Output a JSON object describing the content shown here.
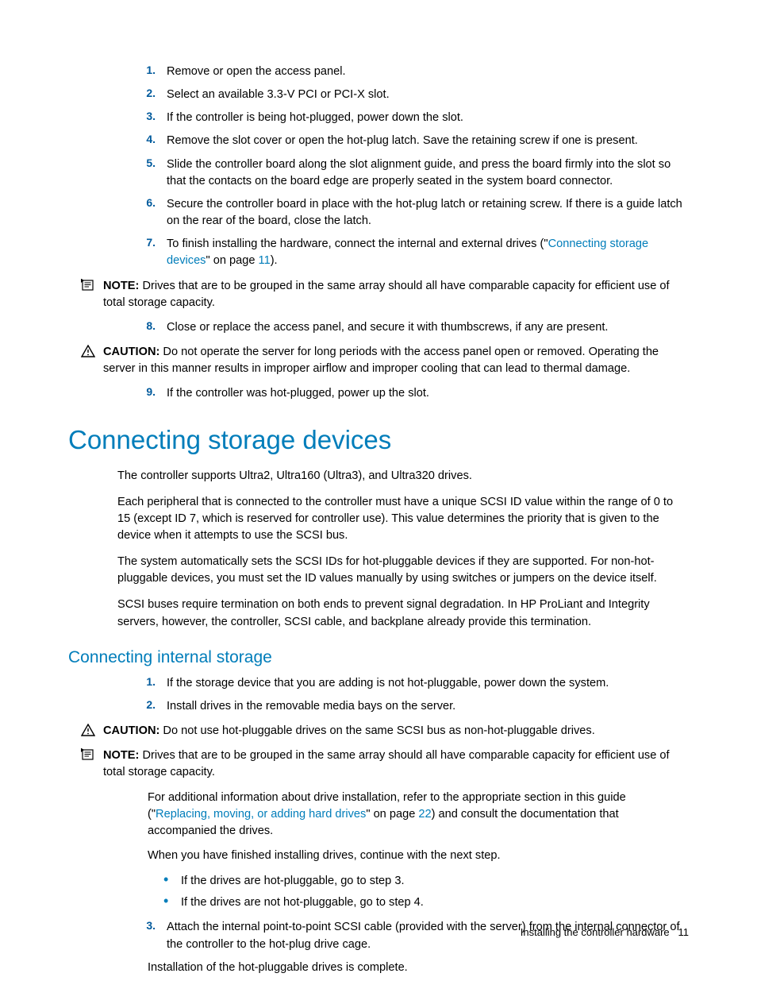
{
  "steps1": {
    "s1": "Remove or open the access panel.",
    "s2": "Select an available 3.3-V PCI or PCI-X slot.",
    "s3": "If the controller is being hot-plugged, power down the slot.",
    "s4": "Remove the slot cover or open the hot-plug latch. Save the retaining screw if one is present.",
    "s5": "Slide the controller board along the slot alignment guide, and press the board firmly into the slot so that the contacts on the board edge are properly seated in the system board connector.",
    "s6": "Secure the controller board in place with the hot-plug latch or retaining screw. If there is a guide latch on the rear of the board, close the latch.",
    "s7_pre": "To finish installing the hardware, connect the internal and external drives (\"",
    "s7_link": "Connecting storage devices",
    "s7_mid": "\" on page ",
    "s7_page": "11",
    "s7_post": ").",
    "s8": "Close or replace the access panel, and secure it with thumbscrews, if any are present.",
    "s9": "If the controller was hot-plugged, power up the slot."
  },
  "labels": {
    "note": "NOTE:",
    "caution": "CAUTION:"
  },
  "note1": " Drives that are to be grouped in the same array should all have comparable capacity for efficient use of total storage capacity.",
  "caution1": " Do not operate the server for long periods with the access panel open or removed. Operating the server in this manner results in improper airflow and improper cooling that can lead to thermal damage.",
  "h1": "Connecting storage devices",
  "csd": {
    "p1": "The controller supports Ultra2, Ultra160 (Ultra3), and Ultra320 drives.",
    "p2": "Each peripheral that is connected to the controller must have a unique SCSI ID value within the range of 0 to 15 (except ID 7, which is reserved for controller use). This value determines the priority that is given to the device when it attempts to use the SCSI bus.",
    "p3": "The system automatically sets the SCSI IDs for hot-pluggable devices if they are supported. For non-hot-pluggable devices, you must set the ID values manually by using switches or jumpers on the device itself.",
    "p4": "SCSI buses require termination on both ends to prevent signal degradation. In HP ProLiant and Integrity servers, however, the controller, SCSI cable, and backplane already provide this termination."
  },
  "h2": "Connecting internal storage",
  "steps2": {
    "s1": "If the storage device that you are adding is not hot-pluggable, power down the system.",
    "s2": "Install drives in the removable media bays on the server.",
    "s3": "Attach the internal point-to-point SCSI cable (provided with the server) from the internal connector of the controller to the hot-plug drive cage.",
    "s3b": "Installation of the hot-pluggable drives is complete."
  },
  "caution2": " Do not use hot-pluggable drives on the same SCSI bus as non-hot-pluggable drives.",
  "note2": " Drives that are to be grouped in the same array should all have comparable capacity for efficient use of total storage capacity.",
  "sub": {
    "p1_pre": "For additional information about drive installation, refer to the appropriate section in this guide (\"",
    "p1_link": "Replacing, moving, or adding hard drives",
    "p1_mid": "\" on page ",
    "p1_page": "22",
    "p1_post": ") and consult the documentation that accompanied the drives.",
    "p2": "When you have finished installing drives, continue with the next step.",
    "b1": "If the drives are hot-pluggable, go to step 3.",
    "b2": "If the drives are not hot-pluggable, go to step 4."
  },
  "nums": {
    "n1": "1.",
    "n2": "2.",
    "n3": "3.",
    "n4": "4.",
    "n5": "5.",
    "n6": "6.",
    "n7": "7.",
    "n8": "8.",
    "n9": "9."
  },
  "footer": {
    "text": "Installing the controller hardware",
    "page": "11"
  }
}
